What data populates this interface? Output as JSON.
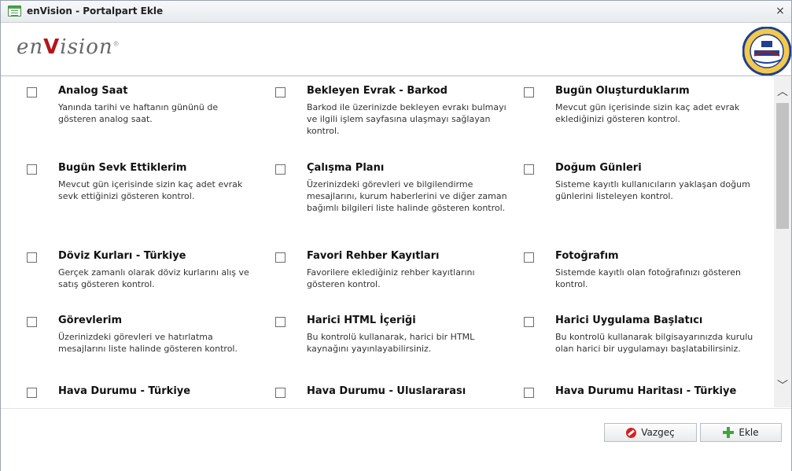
{
  "window": {
    "title": "enVision - Portalpart Ekle",
    "close_glyph": "×"
  },
  "header": {
    "logo_prefix": "en",
    "logo_v": "V",
    "logo_suffix": "ision",
    "logo_mark": "®",
    "logo_colors": {
      "text": "#666666",
      "accent": "#b01818"
    },
    "seal_icon": "university-seal-icon"
  },
  "portalparts": [
    {
      "title": "Analog Saat",
      "desc": "Yanında tarihi ve haftanın gününü de gösteren analog saat."
    },
    {
      "title": "Bekleyen Evrak - Barkod",
      "desc": "Barkod ile üzerinizde bekleyen evrakı bulmayı ve ilgili işlem sayfasına ulaşmayı sağlayan kontrol."
    },
    {
      "title": "Bugün Oluşturduklarım",
      "desc": "Mevcut gün içerisinde sizin kaç adet evrak eklediğinizi gösteren kontrol."
    },
    {
      "title": "Bugün Sevk Ettiklerim",
      "desc": "Mevcut gün içerisinde sizin kaç adet evrak sevk ettiğinizi gösteren kontrol."
    },
    {
      "title": "Çalışma Planı",
      "desc": "Üzerinizdeki görevleri ve bilgilendirme mesajlarını, kurum haberlerini ve diğer zaman bağımlı bilgileri liste halinde gösteren kontrol."
    },
    {
      "title": "Doğum Günleri",
      "desc": "Sisteme kayıtlı kullanıcıların yaklaşan doğum günlerini listeleyen kontrol."
    },
    {
      "title": "Döviz Kurları - Türkiye",
      "desc": "Gerçek zamanlı olarak döviz kurlarını alış ve satış gösteren kontrol."
    },
    {
      "title": "Favori Rehber Kayıtları",
      "desc": "Favorilere eklediğiniz rehber kayıtlarını gösteren kontrol."
    },
    {
      "title": "Fotoğrafım",
      "desc": "Sistemde kayıtlı olan fotoğrafınızı gösteren kontrol."
    },
    {
      "title": "Görevlerim",
      "desc": "Üzerinizdeki görevleri ve hatırlatma mesajlarını liste halinde gösteren kontrol."
    },
    {
      "title": "Harici HTML İçeriği",
      "desc": "Bu kontrolü kullanarak, harici bir HTML kaynağını yayınlayabilirsiniz."
    },
    {
      "title": "Harici Uygulama Başlatıcı",
      "desc": "Bu kontrolü kullanarak bilgisayarınızda kurulu olan harici bir uygulamayı başlatabilirsiniz."
    },
    {
      "title": "Hava Durumu - Türkiye",
      "desc": ""
    },
    {
      "title": "Hava Durumu - Uluslararası",
      "desc": ""
    },
    {
      "title": "Hava Durumu Haritası - Türkiye",
      "desc": ""
    }
  ],
  "footer": {
    "cancel_label": "Vazgeç",
    "cancel_icon": "cancel-icon",
    "add_label": "Ekle",
    "add_icon": "plus-icon"
  },
  "scroll": {
    "up_glyph": "︿",
    "down_glyph": "﹀"
  }
}
